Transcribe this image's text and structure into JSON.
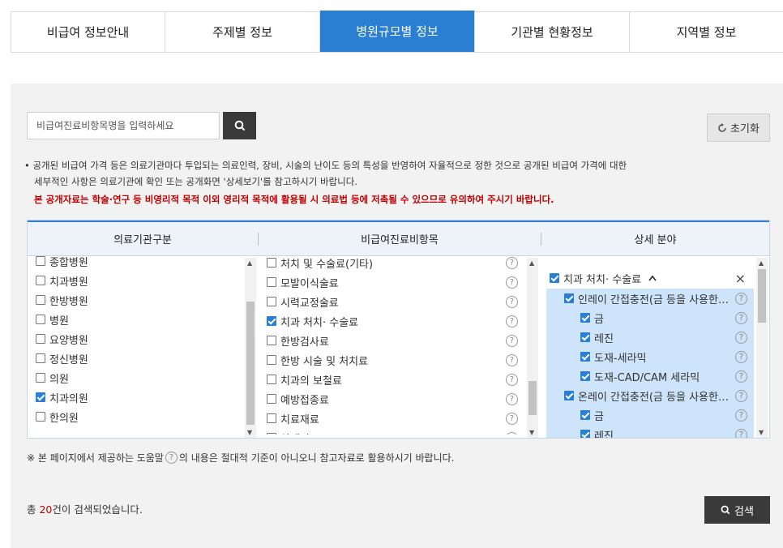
{
  "tabs": [
    {
      "label": "비급여 정보안내",
      "active": false
    },
    {
      "label": "주제별 정보",
      "active": false
    },
    {
      "label": "병원규모별 정보",
      "active": true
    },
    {
      "label": "기관별 현황정보",
      "active": false
    },
    {
      "label": "지역별 정보",
      "active": false
    }
  ],
  "search": {
    "value": "비급여진료비항목명을 입력하세요"
  },
  "reset_label": "초기화",
  "notice": {
    "line1": "• 공개된 비급여 가격 등은 의료기관마다 투입되는 의료인력, 장비, 시술의 난이도 등의 특성을 반영하여 자율적으로 정한 것으로 공개된 비급여 가격에 대한",
    "line2": "세부적인 사항은 의료기관에 확인 또는 공개화면 '상세보기'를 참고하시기 바랍니다.",
    "warning": "본 공개자료는 학술·연구 등 비영리적 목적 이외 영리적 목적에 활용될 시 의료법 등에 저촉될 수 있으므로 유의하여 주시기 바랍니다."
  },
  "columns": {
    "institution": "의료기관구분",
    "items": "비급여진료비항목",
    "detail": "상세 분야"
  },
  "institutions": [
    {
      "label": "종합병원",
      "checked": false
    },
    {
      "label": "치과병원",
      "checked": false
    },
    {
      "label": "한방병원",
      "checked": false
    },
    {
      "label": "병원",
      "checked": false
    },
    {
      "label": "요양병원",
      "checked": false
    },
    {
      "label": "정신병원",
      "checked": false
    },
    {
      "label": "의원",
      "checked": false
    },
    {
      "label": "치과의원",
      "checked": true
    },
    {
      "label": "한의원",
      "checked": false
    }
  ],
  "items": [
    {
      "label": "처치 및 수술료(기타)",
      "checked": false
    },
    {
      "label": "모발이식술료",
      "checked": false
    },
    {
      "label": "시력교정술료",
      "checked": false
    },
    {
      "label": "치과 처치· 수술료",
      "checked": true
    },
    {
      "label": "한방검사료",
      "checked": false
    },
    {
      "label": "한방 시술 및 처치료",
      "checked": false
    },
    {
      "label": "치과의 보철료",
      "checked": false
    },
    {
      "label": "예방접종료",
      "checked": false
    },
    {
      "label": "치료재료",
      "checked": false
    },
    {
      "label": "약제비",
      "checked": false
    }
  ],
  "detail": {
    "group_label": "치과 처치· 수술료",
    "group_chevron_icon": "chevron-up",
    "close_icon": "×",
    "rows": [
      {
        "label": "인레이 간접충전(금 등을 사용한…",
        "level": 1,
        "checked": true
      },
      {
        "label": "금",
        "level": 2,
        "checked": true
      },
      {
        "label": "레진",
        "level": 2,
        "checked": true
      },
      {
        "label": "도재-세라믹",
        "level": 2,
        "checked": true
      },
      {
        "label": "도재-CAD/CAM 세라믹",
        "level": 2,
        "checked": true
      },
      {
        "label": "온레이 간접충전(금 등을 사용한…",
        "level": 1,
        "checked": true
      },
      {
        "label": "금",
        "level": 2,
        "checked": true
      },
      {
        "label": "레진",
        "level": 2,
        "checked": true
      }
    ]
  },
  "help_glyph": "?",
  "footer_note": {
    "before": "※ 본 페이지에서 제공하는 도움말",
    "after": "의 내용은 절대적 기준이 아니오니 참고자료로 활용하시기 바랍니다."
  },
  "result": {
    "prefix": "총 ",
    "count": "20",
    "suffix": "건이 검색되었습니다."
  },
  "search_button_label": "검색",
  "colors": {
    "accent": "#2b7fd3",
    "warning": "#c00000",
    "selected_row": "#cde4fb"
  }
}
